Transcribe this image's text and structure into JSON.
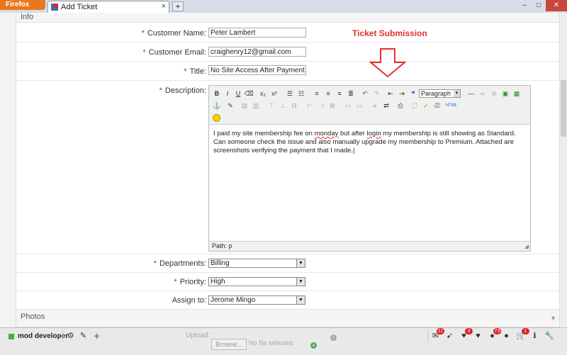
{
  "browser": {
    "app_button": "Firefox",
    "tab_title": "Add Ticket",
    "tab_close": "×",
    "new_tab": "+",
    "window_minimize": "–",
    "window_maximize": "□",
    "window_close": "✕"
  },
  "form": {
    "info_header": "Info",
    "photos_header": "Photos",
    "annotation_title": "Ticket Submission",
    "customer_name": {
      "label": "Customer Name:",
      "value": "Peter Lambert"
    },
    "customer_email": {
      "label": "Customer Email:",
      "value": "craighenry12@gmail.com"
    },
    "title": {
      "label": "Title:",
      "value": "No Site Access After Payment"
    },
    "description": {
      "label": "Description:",
      "text_before": "I paid my site membership fee on ",
      "squiggle_1": "monday",
      "text_mid": " but after ",
      "squiggle_2": "login",
      "text_after": " my membership is still showing as Standard. Can someone check the issue and also manually upgrade my membership to Premium. Attached are screenshots verifying the payment that I made.",
      "format_select": "Paragraph",
      "path": "Path: p"
    },
    "departments": {
      "label": "Departments:",
      "value": "Billing"
    },
    "priority": {
      "label": "Priority:",
      "value": "High"
    },
    "assign_to": {
      "label": "Assign to:",
      "value": "Jerome Mingo"
    },
    "required_mark": "*"
  },
  "upload": {
    "label": "Upload:",
    "browse": "Browse...",
    "no_file": "No file selected."
  },
  "bottom_bar": {
    "mod_label": "mod developer",
    "badges": {
      "messages": "11",
      "twitter": "",
      "favorites": "3",
      "users": "73",
      "cart": "1"
    }
  }
}
